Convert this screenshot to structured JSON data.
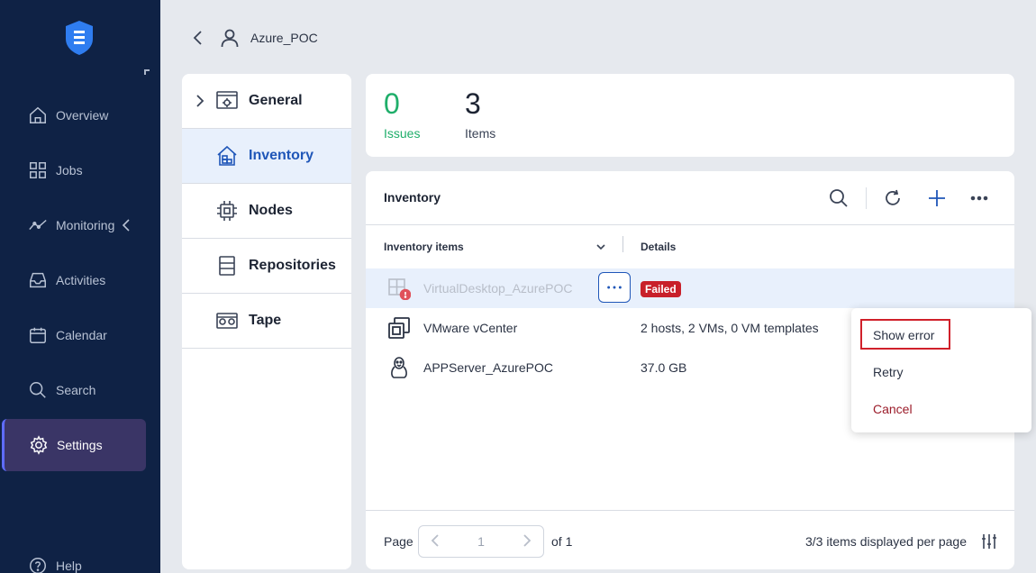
{
  "nav": {
    "items": [
      {
        "label": "Overview",
        "icon": "home-icon"
      },
      {
        "label": "Jobs",
        "icon": "grid-icon"
      },
      {
        "label": "Monitoring",
        "icon": "chart-line-icon"
      },
      {
        "label": "Activities",
        "icon": "inbox-icon"
      },
      {
        "label": "Calendar",
        "icon": "calendar-icon"
      },
      {
        "label": "Search",
        "icon": "search-icon"
      },
      {
        "label": "Settings",
        "icon": "gear-icon"
      },
      {
        "label": "Help",
        "icon": "help-icon"
      }
    ],
    "active": "Settings",
    "accent": "#5f6cff"
  },
  "breadcrumb": {
    "title": "Azure_POC"
  },
  "submenu": {
    "items": [
      {
        "label": "General"
      },
      {
        "label": "Inventory"
      },
      {
        "label": "Nodes"
      },
      {
        "label": "Repositories"
      },
      {
        "label": "Tape"
      }
    ],
    "active": "Inventory"
  },
  "stats": {
    "issues": {
      "value": "0",
      "label": "Issues"
    },
    "items": {
      "value": "3",
      "label": "Items"
    }
  },
  "inventory": {
    "title": "Inventory",
    "columns": {
      "items": "Inventory items",
      "details": "Details"
    },
    "rows": [
      {
        "name": "VirtualDesktop_AzurePOC",
        "details": "Failed",
        "icon": "windows-error-icon",
        "status": "failed"
      },
      {
        "name": "VMware vCenter",
        "details": "2 hosts, 2 VMs, 0 VM templates",
        "icon": "vmware-icon"
      },
      {
        "name": "APPServer_AzurePOC",
        "details": "37.0 GB",
        "icon": "linux-icon"
      }
    ],
    "footer": {
      "page_label": "Page",
      "page_value": "1",
      "of_label": "of 1",
      "per_page": "3/3 items displayed per page"
    }
  },
  "context_menu": {
    "items": [
      "Show error",
      "Retry",
      "Cancel"
    ]
  },
  "colors": {
    "success": "#1fae6a",
    "danger": "#c8202a",
    "primary": "#1f56b8",
    "rail": "#0f2245"
  }
}
